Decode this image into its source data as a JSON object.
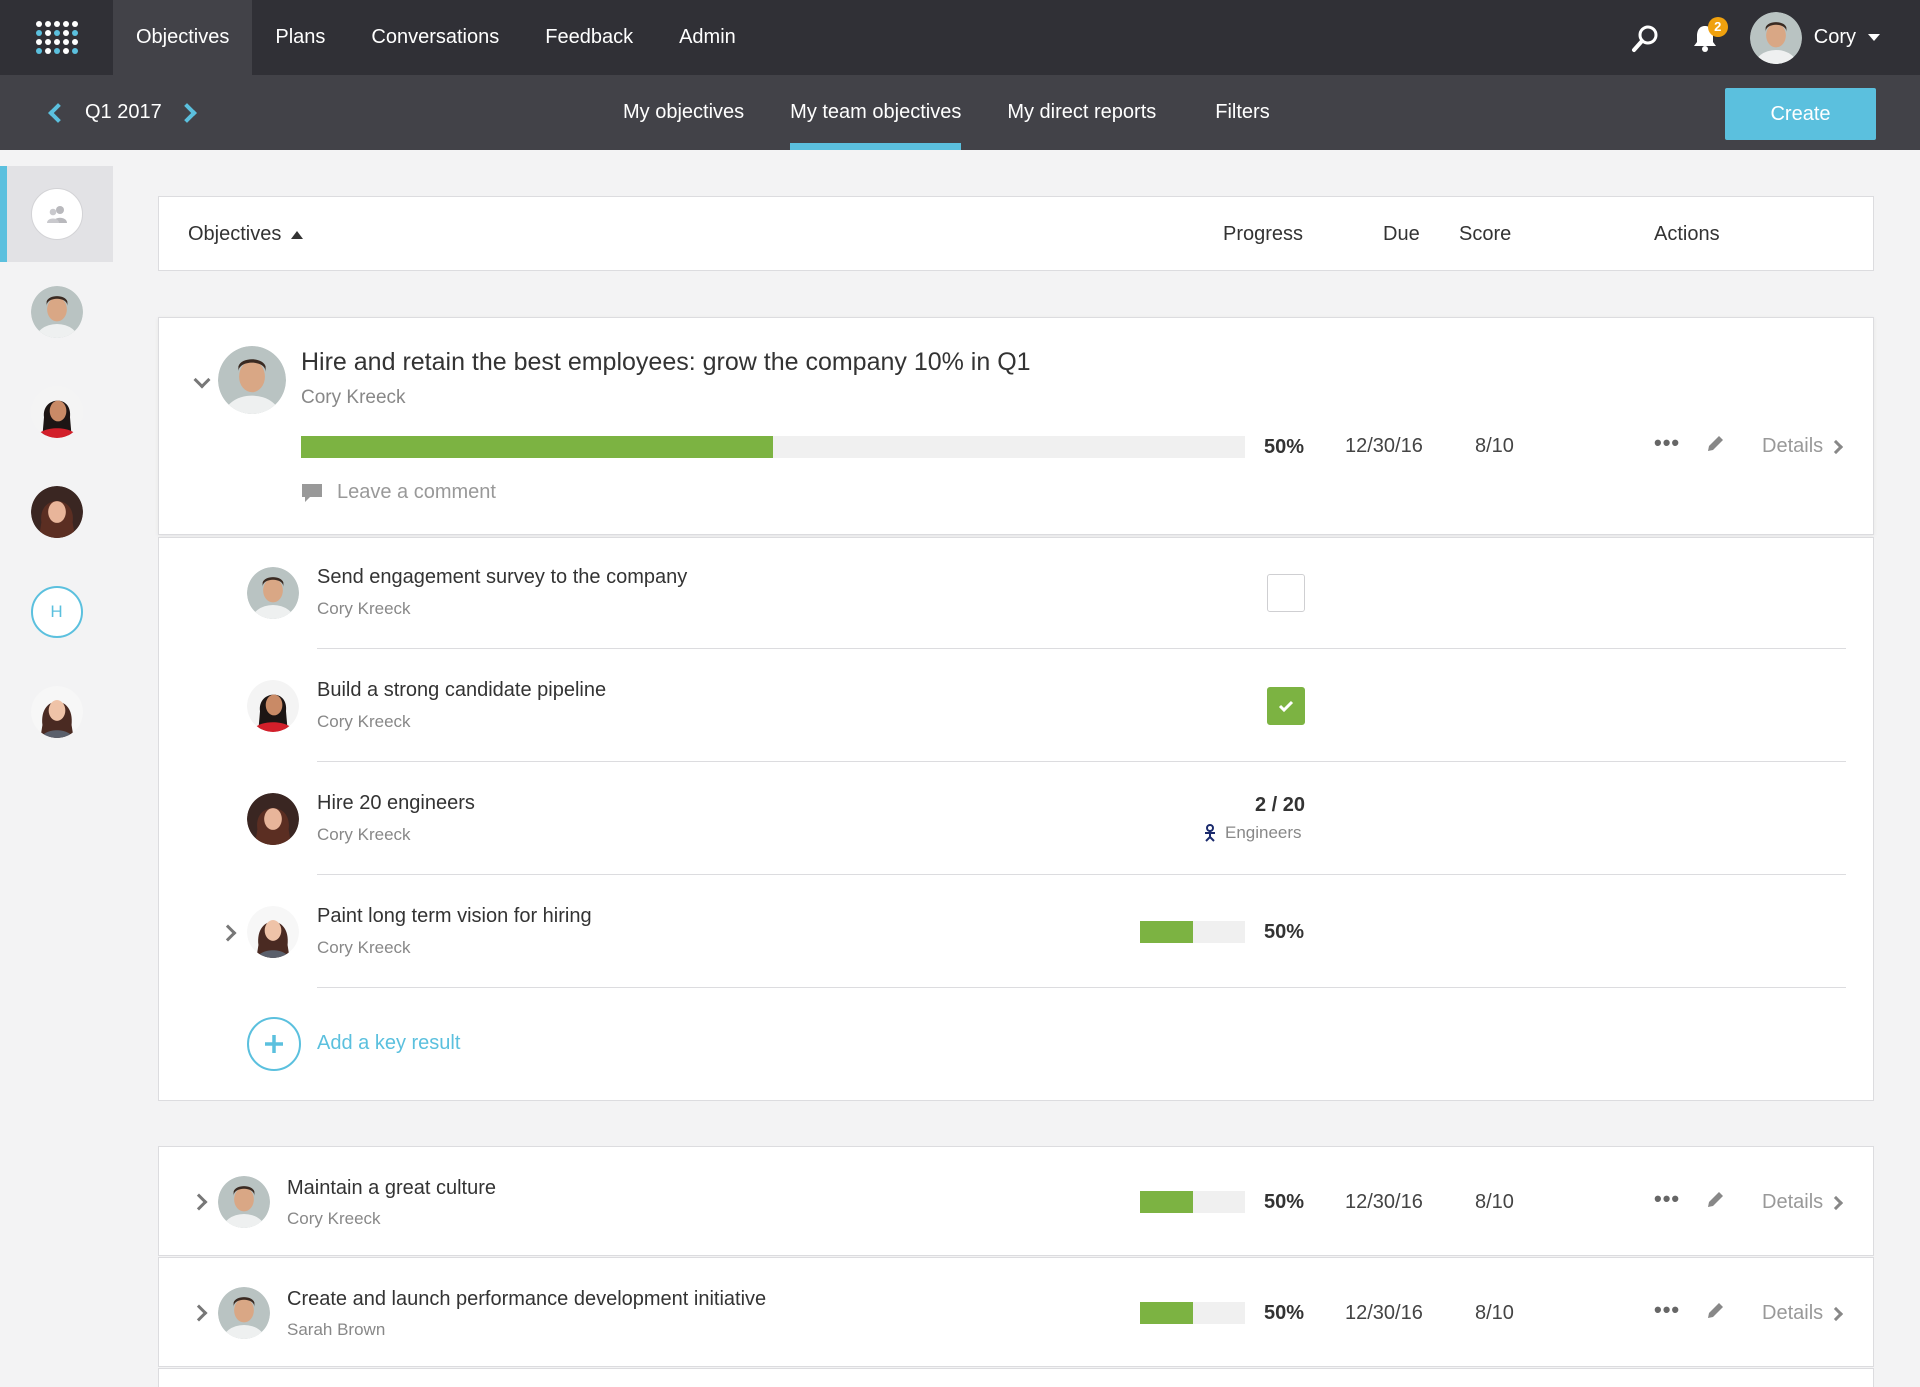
{
  "topnav": {
    "items": [
      "Objectives",
      "Plans",
      "Conversations",
      "Feedback",
      "Admin"
    ],
    "active": "Objectives",
    "notification_count": "2",
    "user_name": "Cory"
  },
  "subnav": {
    "quarter": "Q1 2017",
    "tabs": [
      "My objectives",
      "My team objectives",
      "My direct reports",
      "Filters"
    ],
    "active": "My team objectives",
    "create_label": "Create"
  },
  "rail": {
    "h_initial": "H"
  },
  "header": {
    "objectives": "Objectives",
    "progress": "Progress",
    "due": "Due",
    "score": "Score",
    "actions": "Actions"
  },
  "main_objective": {
    "title": "Hire and retain the best employees: grow the company 10% in Q1",
    "owner": "Cory Kreeck",
    "progress": 50,
    "progress_label": "50%",
    "due": "12/30/16",
    "score": "8/10",
    "comment_label": "Leave a comment",
    "details_label": "Details"
  },
  "key_results": [
    {
      "title": "Send engagement survey to the company",
      "owner": "Cory Kreeck",
      "type": "checkbox",
      "checked": false
    },
    {
      "title": "Build a strong candidate pipeline",
      "owner": "Cory Kreeck",
      "type": "checkbox",
      "checked": true
    },
    {
      "title": "Hire 20 engineers",
      "owner": "Cory Kreeck",
      "type": "count",
      "value": "2 / 20",
      "unit": "Engineers"
    },
    {
      "title": "Paint long term vision for hiring",
      "owner": "Cory Kreeck",
      "type": "progress",
      "progress": 50,
      "progress_label": "50%"
    }
  ],
  "add_key_result_label": "Add a key result",
  "other_objectives": [
    {
      "title": "Maintain a great culture",
      "owner": "Cory Kreeck",
      "progress": 50,
      "progress_label": "50%",
      "due": "12/30/16",
      "score": "8/10",
      "details_label": "Details"
    },
    {
      "title": "Create and launch performance development initiative",
      "owner": "Sarah Brown",
      "progress": 50,
      "progress_label": "50%",
      "due": "12/30/16",
      "score": "8/10",
      "details_label": "Details"
    }
  ],
  "colors": {
    "topbar": "#303036",
    "subbar": "#424248",
    "accent": "#5bc0de",
    "progress": "#7cb342",
    "badge": "#f0a10e"
  }
}
